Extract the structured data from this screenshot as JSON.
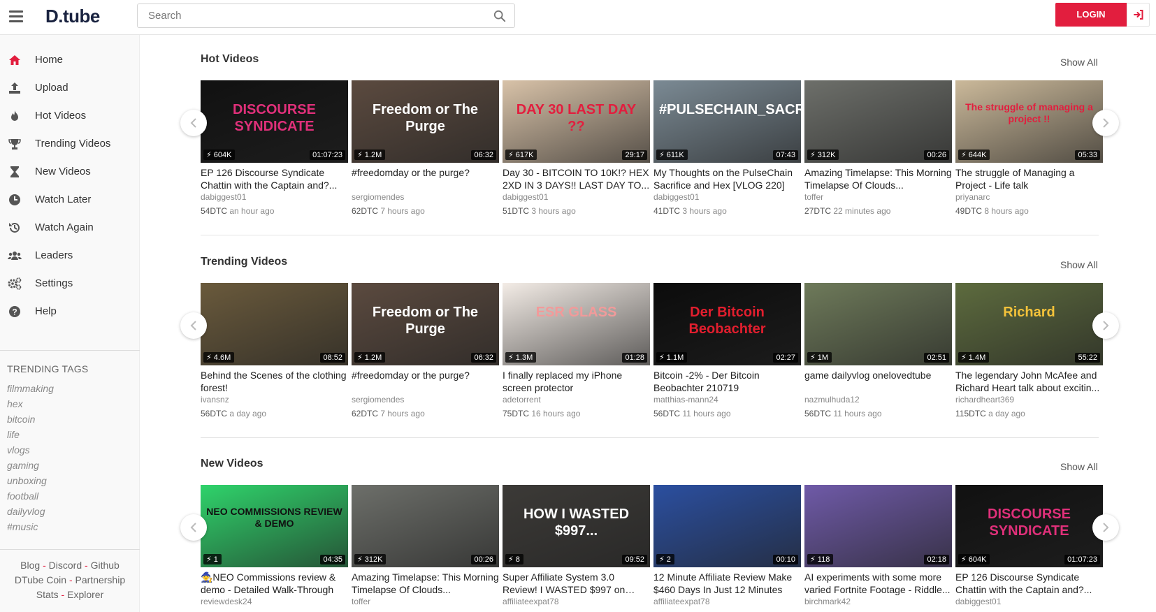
{
  "header": {
    "logo": "D.tube",
    "search_placeholder": "Search",
    "login_label": "LOGIN"
  },
  "sidebar": {
    "items": [
      {
        "label": "Home",
        "icon": "home-icon"
      },
      {
        "label": "Upload",
        "icon": "upload-icon"
      },
      {
        "label": "Hot Videos",
        "icon": "flame-icon"
      },
      {
        "label": "Trending Videos",
        "icon": "trophy-icon"
      },
      {
        "label": "New Videos",
        "icon": "hourglass-icon"
      },
      {
        "label": "Watch Later",
        "icon": "clock-icon"
      },
      {
        "label": "Watch Again",
        "icon": "history-icon"
      },
      {
        "label": "Leaders",
        "icon": "users-icon"
      },
      {
        "label": "Settings",
        "icon": "gears-icon"
      },
      {
        "label": "Help",
        "icon": "help-icon"
      }
    ],
    "tags_title": "TRENDING TAGS",
    "tags": [
      "filmmaking",
      "hex",
      "bitcoin",
      "life",
      "vlogs",
      "gaming",
      "unboxing",
      "football",
      "dailyvlog",
      "#music"
    ],
    "footer": {
      "blog": "Blog",
      "discord": "Discord",
      "github": "Github",
      "coin": "DTube Coin",
      "partnership": "Partnership",
      "stats": "Stats",
      "explorer": "Explorer",
      "sep": "-"
    }
  },
  "accent_color": "#e21e3e",
  "sections": [
    {
      "title": "Hot Videos",
      "show_all": "Show All",
      "videos": [
        {
          "title": "EP 126 Discourse Syndicate Chattin with the Captain and?...",
          "author": "dabiggest01",
          "dtc": "54DTC",
          "time": "an hour ago",
          "views": "604K",
          "duration": "01:07:23",
          "thumb_text": "DISCOURSE SYNDICATE",
          "bg": "#111111",
          "fg": "#e0307a"
        },
        {
          "title": "#freedomday or the purge?",
          "author": "sergiomendes",
          "dtc": "62DTC",
          "time": "7 hours ago",
          "views": "1.2M",
          "duration": "06:32",
          "thumb_text": "Freedom or The Purge",
          "bg": "#5b4a3f",
          "fg": "#ffffff"
        },
        {
          "title": "Day 30 - BITCOIN TO 10K!? HEX 2XD IN 3 DAYS!! LAST DAY TO...",
          "author": "dabiggest01",
          "dtc": "51DTC",
          "time": "3 hours ago",
          "views": "617K",
          "duration": "29:17",
          "thumb_text": "DAY 30 LAST DAY ??",
          "bg": "#d8c2a8",
          "fg": "#e21e3e"
        },
        {
          "title": "My Thoughts on the PulseChain Sacrifice and Hex [VLOG 220]",
          "author": "dabiggest01",
          "dtc": "41DTC",
          "time": "3 hours ago",
          "views": "611K",
          "duration": "07:43",
          "thumb_text": "#PULSECHAIN_SACRIFICE",
          "bg": "#7b8a94",
          "fg": "#ffffff"
        },
        {
          "title": "Amazing Timelapse: This Morning Timelapse Of Clouds...",
          "author": "toffer",
          "dtc": "27DTC",
          "time": "22 minutes ago",
          "views": "312K",
          "duration": "00:26",
          "thumb_text": "",
          "bg": "#6d6f6a",
          "fg": "#ffffff"
        },
        {
          "title": "The struggle of Managing a Project - Life talk",
          "author": "priyanarc",
          "dtc": "49DTC",
          "time": "8 hours ago",
          "views": "644K",
          "duration": "05:33",
          "thumb_text": "The struggle of managing a project !!",
          "bg": "#cbb99a",
          "fg": "#e21e3e"
        }
      ]
    },
    {
      "title": "Trending Videos",
      "show_all": "Show All",
      "videos": [
        {
          "title": "Behind the Scenes of the clothing forest!",
          "author": "ivansnz",
          "dtc": "56DTC",
          "time": "a day ago",
          "views": "4.6M",
          "duration": "08:52",
          "thumb_text": "",
          "bg": "#6a5a3c",
          "fg": "#ffffff"
        },
        {
          "title": "#freedomday or the purge?",
          "author": "sergiomendes",
          "dtc": "62DTC",
          "time": "7 hours ago",
          "views": "1.2M",
          "duration": "06:32",
          "thumb_text": "Freedom or The Purge",
          "bg": "#5b4a3f",
          "fg": "#ffffff"
        },
        {
          "title": "I finally replaced my iPhone screen protector",
          "author": "adetorrent",
          "dtc": "75DTC",
          "time": "16 hours ago",
          "views": "1.3M",
          "duration": "01:28",
          "thumb_text": "ESR GLASS",
          "bg": "#f3ece6",
          "fg": "#f29a9a"
        },
        {
          "title": "Bitcoin -2% - Der Bitcoin Beobachter 210719",
          "author": "matthias-mann24",
          "dtc": "56DTC",
          "time": "11 hours ago",
          "views": "1.1M",
          "duration": "02:27",
          "thumb_text": "Der Bitcoin Beobachter",
          "bg": "#0c0c0c",
          "fg": "#e21e2e"
        },
        {
          "title": "game dailyvlog onelovedtube",
          "author": "nazmulhuda12",
          "dtc": "56DTC",
          "time": "11 hours ago",
          "views": "1M",
          "duration": "02:51",
          "thumb_text": "",
          "bg": "#6e7a5a",
          "fg": "#ffffff"
        },
        {
          "title": "The legendary John McAfee and Richard Heart talk about excitin...",
          "author": "richardheart369",
          "dtc": "115DTC",
          "time": "a day ago",
          "views": "1.4M",
          "duration": "55:22",
          "thumb_text": "Richard",
          "bg": "#5d6b3e",
          "fg": "#f3c23a"
        }
      ]
    },
    {
      "title": "New Videos",
      "show_all": "Show All",
      "videos": [
        {
          "title": "🧙NEO Commissions review & demo - Detailed Walk-Through",
          "author": "reviewdesk24",
          "dtc": "",
          "time": "",
          "views": "1",
          "duration": "04:35",
          "thumb_text": "NEO COMMISSIONS REVIEW & DEMO",
          "bg": "#2fd36b",
          "fg": "#111111"
        },
        {
          "title": "Amazing Timelapse: This Morning Timelapse Of Clouds...",
          "author": "toffer",
          "dtc": "",
          "time": "",
          "views": "312K",
          "duration": "00:26",
          "thumb_text": "",
          "bg": "#6d6f6a",
          "fg": "#ffffff"
        },
        {
          "title": "Super Affiliate System 3.0 Review! I WASTED $997 on this...",
          "author": "affiliateexpat78",
          "dtc": "",
          "time": "",
          "views": "8",
          "duration": "09:52",
          "thumb_text": "HOW I WASTED $997...",
          "bg": "#3c3a37",
          "fg": "#ffffff"
        },
        {
          "title": "12 Minute Affiliate Review Make $460 Days In Just 12 Minutes",
          "author": "affiliateexpat78",
          "dtc": "",
          "time": "",
          "views": "2",
          "duration": "00:10",
          "thumb_text": "",
          "bg": "#2b4fa0",
          "fg": "#ffffff"
        },
        {
          "title": "AI experiments with some more varied Fortnite Footage - Riddle...",
          "author": "birchmark42",
          "dtc": "",
          "time": "",
          "views": "118",
          "duration": "02:18",
          "thumb_text": "",
          "bg": "#6f5aa8",
          "fg": "#ffffff"
        },
        {
          "title": "EP 126 Discourse Syndicate Chattin with the Captain and?...",
          "author": "dabiggest01",
          "dtc": "",
          "time": "",
          "views": "604K",
          "duration": "01:07:23",
          "thumb_text": "DISCOURSE SYNDICATE",
          "bg": "#111111",
          "fg": "#e0307a"
        }
      ]
    }
  ]
}
